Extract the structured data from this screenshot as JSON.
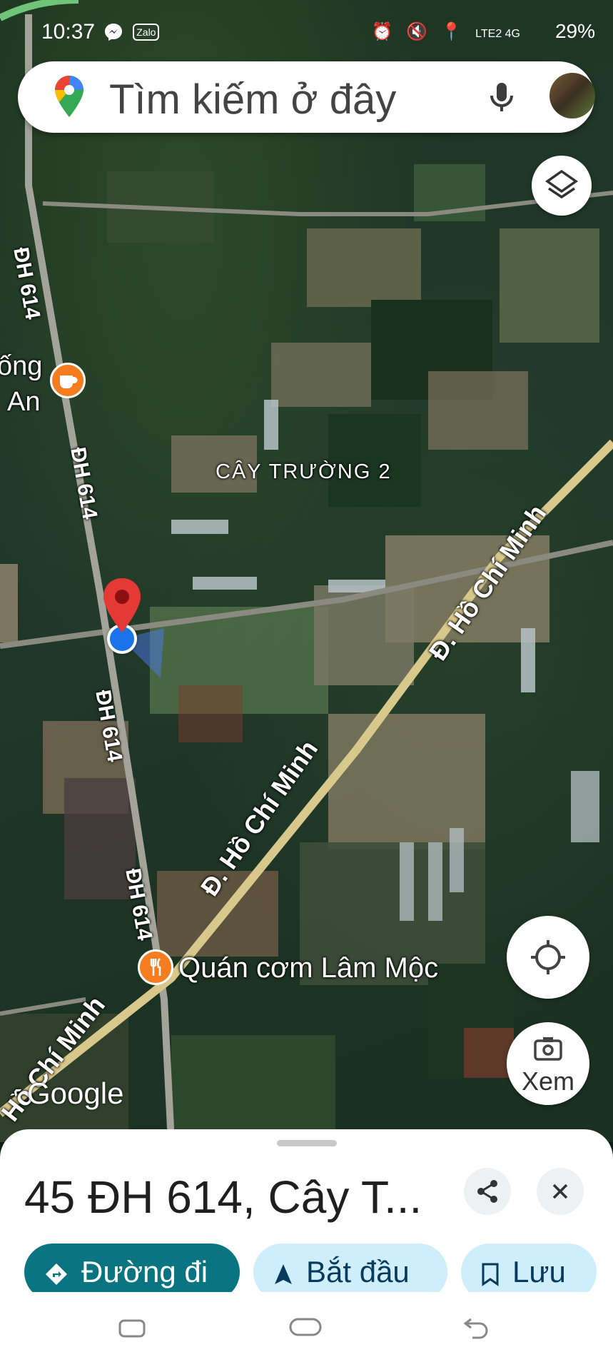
{
  "status_bar": {
    "time": "10:37",
    "left_icons": "messenger-icon zalo-icon",
    "zalo": "Zalo",
    "right_indicators": "LTE2 4G",
    "battery": "29%"
  },
  "search": {
    "placeholder": "Tìm kiếm ở đây"
  },
  "map": {
    "area_label": "CÂY TRƯỜNG 2",
    "road_labels": {
      "dh614_a": "ĐH 614",
      "dh614_b": "ĐH 614",
      "dh614_c": "ĐH 614",
      "dh614_d": "ĐH 614",
      "hcm_a": "Đ. Hồ Chí Minh",
      "hcm_b": "Đ. Hồ Chí Minh",
      "hcm_c": "Hồ Chí Minh"
    },
    "poi_partial_line1": "ống",
    "poi_partial_line2": "An",
    "restaurant": "Quán cơm Lâm Mộc",
    "attribution": "Google"
  },
  "buttons": {
    "lens_label": "Xem"
  },
  "place_sheet": {
    "address": "45 ĐH 614, Cây T...",
    "actions": {
      "directions": "Đường đi",
      "start": "Bắt đầu",
      "save": "Lưu"
    }
  },
  "colors": {
    "primary_chip": "#0b7481",
    "secondary_chip": "#cdeefa",
    "pin": "#e53935",
    "location_dot": "#1a73e8",
    "poi_orange": "#f57c1f"
  }
}
